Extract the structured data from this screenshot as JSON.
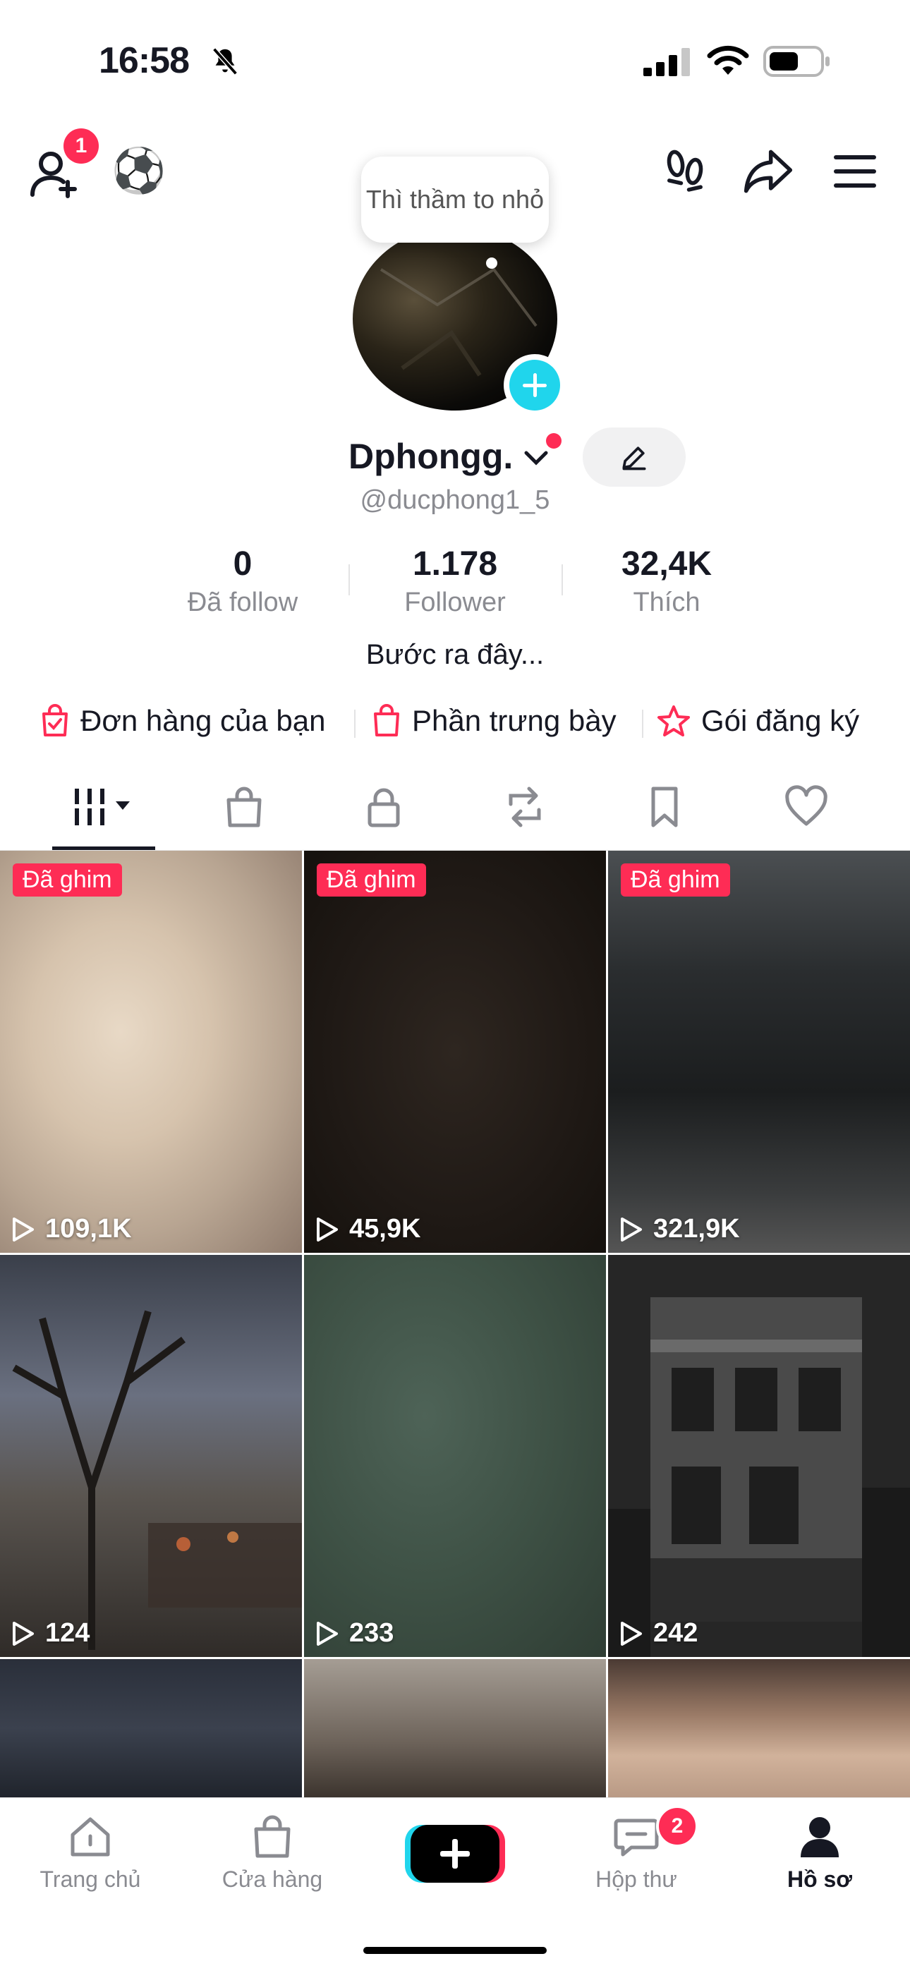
{
  "status_bar": {
    "time": "16:58"
  },
  "header": {
    "add_friend_badge": "1",
    "emoji": "⚽️"
  },
  "tooltip": {
    "text": "Thì thầm to nhỏ"
  },
  "profile": {
    "display_name": "Dphongg.",
    "handle": "@ducphong1_5",
    "bio": "Bước ra đây..."
  },
  "stats": [
    {
      "value": "0",
      "label": "Đã follow"
    },
    {
      "value": "1.178",
      "label": "Follower"
    },
    {
      "value": "32,4K",
      "label": "Thích"
    }
  ],
  "links": [
    {
      "label": "Đơn hàng của bạn",
      "icon": "bag-check-icon"
    },
    {
      "label": "Phần trưng bày",
      "icon": "shopping-bag-icon"
    },
    {
      "label": "Gói đăng ký",
      "icon": "star-icon"
    }
  ],
  "tabs": [
    "videos-tab",
    "shop-tab",
    "private-tab",
    "repost-tab",
    "saved-tab",
    "liked-tab"
  ],
  "grid": {
    "pinned_label": "Đã ghim",
    "videos": [
      {
        "views": "109,1K",
        "pinned": true
      },
      {
        "views": "45,9K",
        "pinned": true
      },
      {
        "views": "321,9K",
        "pinned": true
      },
      {
        "views": "124",
        "pinned": false
      },
      {
        "views": "233",
        "pinned": false
      },
      {
        "views": "242",
        "pinned": false
      }
    ]
  },
  "bottom_nav": {
    "home": "Trang chủ",
    "shop": "Cửa hàng",
    "inbox": "Hộp thư",
    "inbox_badge": "2",
    "profile": "Hồ sơ"
  },
  "colors": {
    "accent": "#fe2c55",
    "cyan": "#20d5ec",
    "text": "#161823",
    "muted": "#8a8b91"
  }
}
